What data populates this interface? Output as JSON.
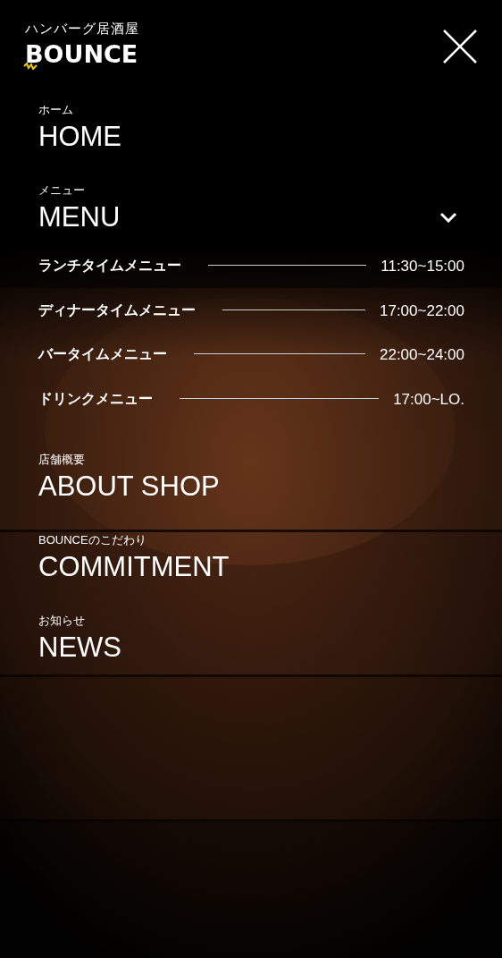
{
  "header": {
    "tagline": "ハンバーグ居酒屋",
    "logo": "BOUNCE"
  },
  "nav": [
    {
      "sub": "ホーム",
      "title": "HOME"
    },
    {
      "sub": "メニュー",
      "title": "MENU",
      "expanded": true,
      "children": [
        {
          "label": "ランチタイムメニュー",
          "time": "11:30~15:00"
        },
        {
          "label": "ディナータイムメニュー",
          "time": "17:00~22:00"
        },
        {
          "label": "バータイムメニュー",
          "time": "22:00~24:00"
        },
        {
          "label": "ドリンクメニュー",
          "time": "17:00~LO."
        }
      ]
    },
    {
      "sub": "店舗概要",
      "title": "ABOUT SHOP"
    },
    {
      "sub": "BOUNCEのこだわり",
      "title": "COMMITMENT"
    },
    {
      "sub": "お知らせ",
      "title": "NEWS"
    }
  ]
}
